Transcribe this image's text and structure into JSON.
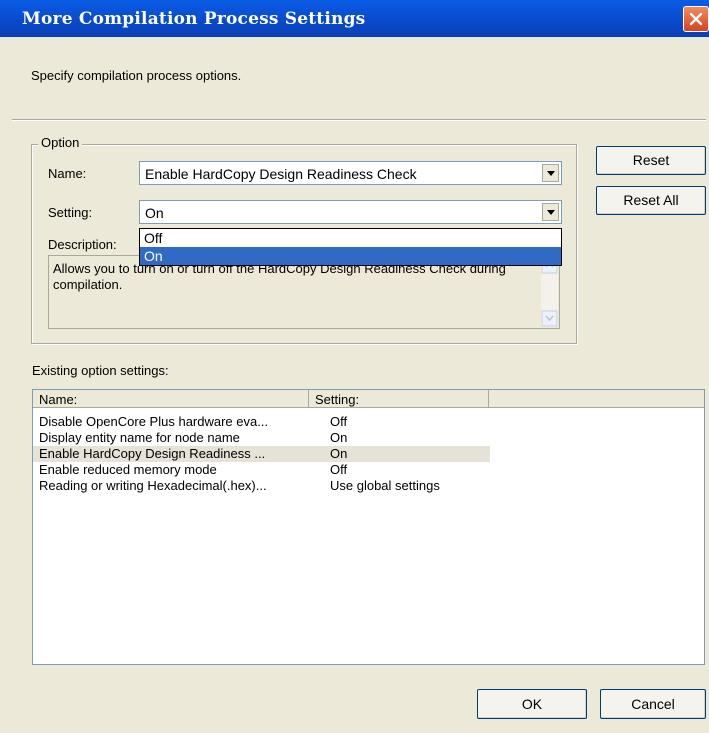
{
  "window": {
    "title": "More Compilation Process Settings",
    "close_icon": "close-icon"
  },
  "intro": "Specify compilation process options.",
  "option_group": {
    "label": "Option",
    "name_label": "Name:",
    "name_value": "Enable HardCopy Design Readiness Check",
    "setting_label": "Setting:",
    "setting_value": "On",
    "setting_options": [
      "Off",
      "On"
    ],
    "setting_highlighted": "On",
    "description_label": "Description:",
    "description_text": "Allows you to turn on or turn off the HardCopy Design Readiness Check during compilation."
  },
  "buttons": {
    "reset": "Reset",
    "reset_all": "Reset All",
    "ok": "OK",
    "cancel": "Cancel"
  },
  "existing": {
    "label": "Existing option settings:",
    "columns": [
      "Name:",
      "Setting:"
    ],
    "rows": [
      {
        "name": "Disable OpenCore Plus hardware eva...",
        "setting": "Off"
      },
      {
        "name": "Display entity name for node name",
        "setting": "On"
      },
      {
        "name": "Enable HardCopy Design Readiness ...",
        "setting": "On"
      },
      {
        "name": "Enable reduced memory mode",
        "setting": "Off"
      },
      {
        "name": "Reading or writing Hexadecimal(.hex)...",
        "setting": "Use global settings"
      }
    ],
    "selected_row_index": 2
  },
  "colors": {
    "title_bar": "#0a5ce6",
    "dialog_bg": "#ece9d8",
    "highlight": "#316ac5",
    "selected_row": "#e6e2d6"
  }
}
